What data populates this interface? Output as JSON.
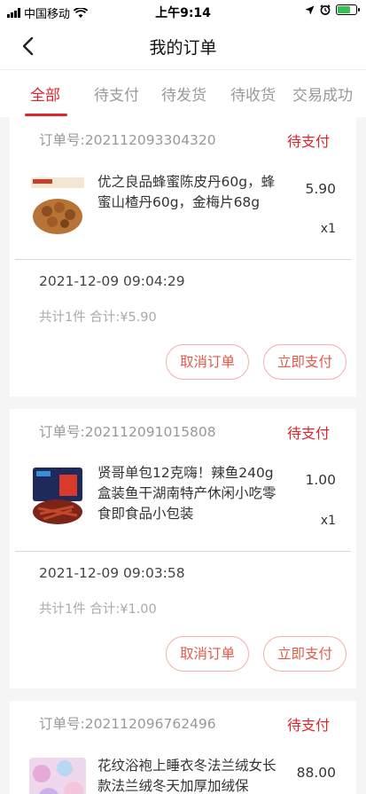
{
  "status_bar": {
    "carrier": "中国移动",
    "time": "上午9:14",
    "battery_level": 0.7,
    "icons": [
      "signal-icon",
      "wifi-icon",
      "location-icon",
      "alarm-icon",
      "battery-icon"
    ]
  },
  "header": {
    "title": "我的订单",
    "back_icon": "chevron-left-icon"
  },
  "tabs": [
    {
      "label": "全部",
      "active": true
    },
    {
      "label": "待支付",
      "active": false
    },
    {
      "label": "待发货",
      "active": false
    },
    {
      "label": "待收货",
      "active": false
    },
    {
      "label": "交易成功",
      "active": false
    }
  ],
  "colors": {
    "accent": "#e0242b",
    "button_text": "#e05a48",
    "button_border": "#efb0a8",
    "background": "#f5f5f5"
  },
  "orders": [
    {
      "order_no": "订单号:202112093304320",
      "status": "待支付",
      "product_name": "优之良品蜂蜜陈皮丹60g，蜂蜜山楂丹60g，金梅片68g",
      "price": "5.90",
      "qty": "x1",
      "time": "2021-12-09 09:04:29",
      "total": "共计1件 合计:¥5.90",
      "cancel_label": "取消订单",
      "pay_label": "立即支付"
    },
    {
      "order_no": "订单号:202112091015808",
      "status": "待支付",
      "product_name": "贤哥单包12克嗨！辣鱼240g盒装鱼干湖南特产休闲小吃零食即食品小包装",
      "price": "1.00",
      "qty": "x1",
      "time": "2021-12-09 09:03:58",
      "total": "共计1件 合计:¥1.00",
      "cancel_label": "取消订单",
      "pay_label": "立即支付"
    },
    {
      "order_no": "订单号:202112096762496",
      "status": "待支付",
      "product_name": "花纹浴袍上睡衣冬法兰绒女长款法兰绒冬天加厚加绒保",
      "price": "88.00"
    }
  ]
}
